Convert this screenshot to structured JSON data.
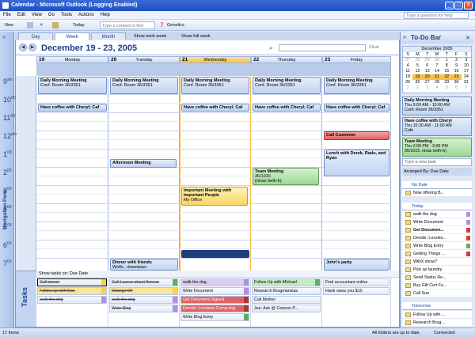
{
  "title": "Calendar - Microsoft Outlook (Logging Enabled)",
  "window_buttons": [
    "_",
    "□",
    "✕"
  ],
  "menu": [
    "File",
    "Edit",
    "View",
    "Go",
    "Tools",
    "Actions",
    "Help"
  ],
  "help_placeholder": "Type a question for help",
  "toolbar": {
    "new": "New",
    "today": "Today",
    "contact_placeholder": "Type a contact to find",
    "generic": "Genetics"
  },
  "nav_pane_label": "Navigation Pane",
  "view_tabs": [
    "Day",
    "Week",
    "Month"
  ],
  "view_options": {
    "work": "Show work week",
    "full": "Show full week"
  },
  "date_range": "December 19 - 23, 2005",
  "search_btn": "Clear",
  "days": [
    {
      "num": "19",
      "name": "Monday"
    },
    {
      "num": "20",
      "name": "Tuesday"
    },
    {
      "num": "21",
      "name": "Wednesday"
    },
    {
      "num": "22",
      "name": "Thursday"
    },
    {
      "num": "23",
      "name": "Friday"
    }
  ],
  "hours": [
    {
      "h": "9",
      "m": "00",
      "pm": "am"
    },
    {
      "h": "10",
      "m": "00"
    },
    {
      "h": "11",
      "m": "00"
    },
    {
      "h": "12",
      "m": "pm"
    },
    {
      "h": "1",
      "m": "00"
    },
    {
      "h": "2",
      "m": "00"
    },
    {
      "h": "3",
      "m": "00"
    },
    {
      "h": "4",
      "m": "00"
    },
    {
      "h": "5",
      "m": "00"
    },
    {
      "h": "6",
      "m": "00"
    },
    {
      "h": "7",
      "m": "00"
    }
  ],
  "appointments": {
    "standup": {
      "title": "Daily Morning Meeting",
      "loc": "Conf. Room 36/3351"
    },
    "coffee": "Have coffee with Cheryl; Caf",
    "call_customer": "Call Customer",
    "lunch": "Lunch with Derek, Radu, and Ryan",
    "afternoon": "Afternoon Meeting",
    "team_meeting": {
      "title": "Team Meeting",
      "loc": "36/1015",
      "who": "(nixac beth-b)"
    },
    "important": {
      "title": "Important Meeting with Important People",
      "loc": "My Office"
    },
    "dinner": {
      "title": "Dinner with friends",
      "loc": "Wolfs - downtown"
    },
    "johns_party": "John's party"
  },
  "tasks_label": "Tasks",
  "tasks_header": "Show tasks on: Due Date",
  "task_columns": [
    [
      "Call mover",
      "Follow up with Dan",
      "walk the dog"
    ],
    [
      "Call Lauren about flowers",
      "Change Oil",
      "walk the dog",
      "Write Blog"
    ],
    [
      "walk the dog",
      "Write Document",
      "Get Document Signed",
      "Decide: Lossless Comp-ring",
      "Write Blog Entry"
    ],
    [
      "Follow Up with Michael",
      "Research Brugmansias",
      "Call Mother",
      "Joe: Ask @ Caneon P..."
    ],
    [
      "Find accountant online",
      "Hank owes you $10"
    ]
  ],
  "todo_bar": {
    "title": "To-Do Bar",
    "month": "December 2005",
    "weekdays": [
      "S",
      "M",
      "T",
      "W",
      "T",
      "F",
      "S"
    ],
    "weeks": [
      [
        "27",
        "28",
        "29",
        "30",
        "1",
        "2",
        "3"
      ],
      [
        "4",
        "5",
        "6",
        "7",
        "8",
        "9",
        "10"
      ],
      [
        "11",
        "12",
        "13",
        "14",
        "15",
        "16",
        "17"
      ],
      [
        "18",
        "19",
        "20",
        "21",
        "22",
        "23",
        "24"
      ],
      [
        "25",
        "26",
        "27",
        "28",
        "29",
        "30",
        "31"
      ],
      [
        "1",
        "2",
        "3",
        "4",
        "5",
        "6",
        "7"
      ]
    ],
    "upcoming": [
      {
        "title": "Daily Morning Meeting",
        "time": "Thu 9:00 AM - 10:00 AM",
        "loc": "Conf. Room 36/3351"
      },
      {
        "title": "Have coffee with Cheryl",
        "time": "Thu 10:30 AM - 11:00 AM",
        "loc": "Cafe"
      },
      {
        "title": "Team Meeting",
        "time": "Thu 2:00 PM - 3:00 PM",
        "loc": "36/1015, nixac beth-b)"
      }
    ],
    "new_task": "Type a new task",
    "arranged": "Arranged By: Due Date",
    "groups": {
      "nodate": "No Date",
      "today": "Today",
      "tomorrow": "Tomorrow"
    },
    "nodate_tasks": [
      "Now offering B..."
    ],
    "today_tasks": [
      "walk the dog",
      "Write Document",
      "Get Documen...",
      "Decide: Lossles...",
      "Write Blog Entry",
      "Getting Things ...",
      "WilliX show?",
      "Pick up laundry",
      "Send Status Re...",
      "Buy Gift Cert Fo...",
      "Call Sue"
    ],
    "tomorrow_tasks": [
      "Follow Up with ...",
      "Research Brug..."
    ]
  },
  "status": {
    "items": "17 Items",
    "folders": "All folders are up to date.",
    "conn": "Connected"
  }
}
